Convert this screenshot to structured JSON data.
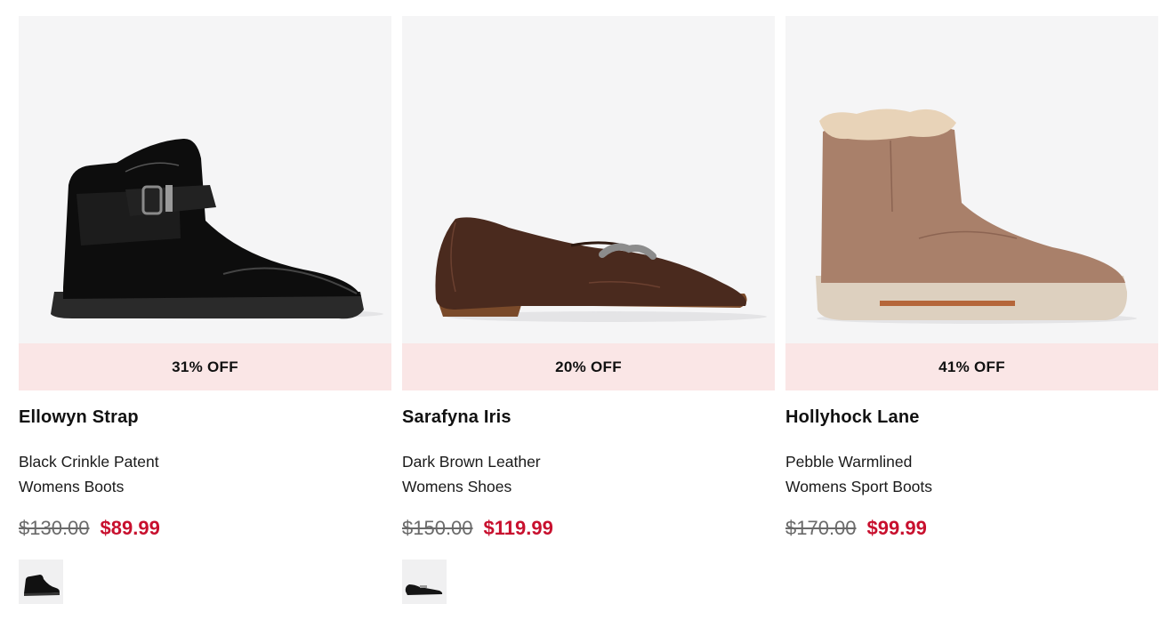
{
  "products": [
    {
      "badge": "31% OFF",
      "name": "Ellowyn Strap",
      "color": "Black Crinkle Patent",
      "category": "Womens Boots",
      "original_price": "$130.00",
      "sale_price": "$89.99",
      "has_swatch": true,
      "image_icon": "black-ankle-boot-image"
    },
    {
      "badge": "20% OFF",
      "name": "Sarafyna Iris",
      "color": "Dark Brown Leather",
      "category": "Womens Shoes",
      "original_price": "$150.00",
      "sale_price": "$119.99",
      "has_swatch": true,
      "image_icon": "brown-loafer-image"
    },
    {
      "badge": "41% OFF",
      "name": "Hollyhock Lane",
      "color": "Pebble Warmlined",
      "category": "Womens Sport Boots",
      "original_price": "$170.00",
      "sale_price": "$99.99",
      "has_swatch": false,
      "image_icon": "tan-warmlined-boot-image"
    }
  ],
  "colors": {
    "badge_bg": "#fae6e6",
    "image_bg": "#f5f5f6",
    "sale_price": "#c8102e",
    "original_price": "#6a6a6a"
  }
}
